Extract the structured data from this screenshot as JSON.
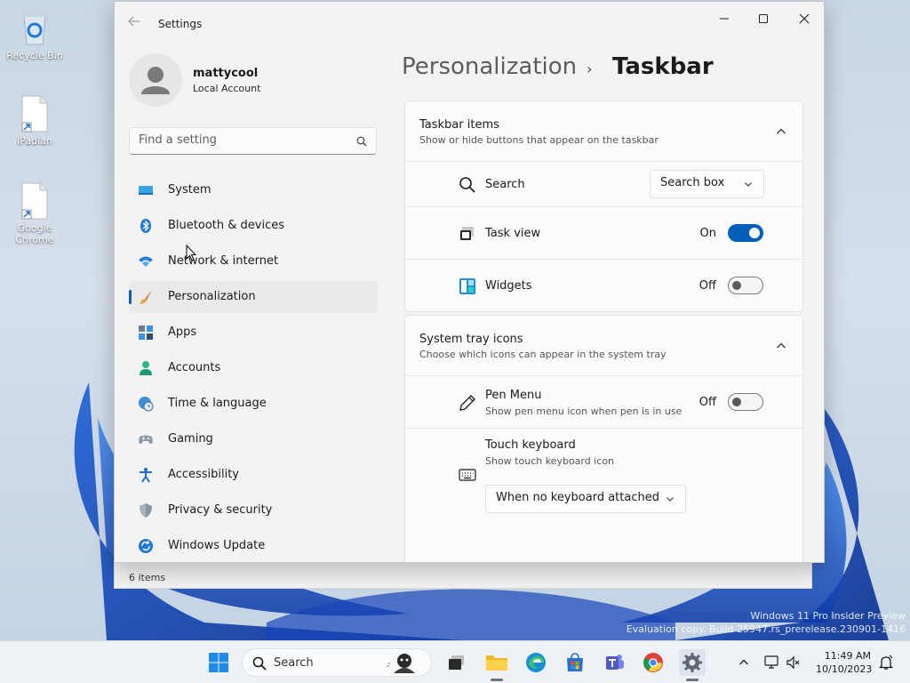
{
  "desktop": {
    "icons": [
      {
        "label": "Recycle Bin"
      },
      {
        "label": "iPadian"
      },
      {
        "label": "Google Chrome"
      }
    ],
    "watermark_line1": "Windows 11 Pro Insider Preview",
    "watermark_line2": "Evaluation copy. Build 25947.rs_prerelease.230901-1416"
  },
  "background_window": {
    "status_text": "6 items"
  },
  "window": {
    "title": "Settings"
  },
  "profile": {
    "name": "mattycool",
    "account_type": "Local Account"
  },
  "search": {
    "placeholder": "Find a setting"
  },
  "nav": {
    "items": [
      {
        "label": "System",
        "icon": "monitor-icon"
      },
      {
        "label": "Bluetooth & devices",
        "icon": "bluetooth-icon"
      },
      {
        "label": "Network & internet",
        "icon": "wifi-icon"
      },
      {
        "label": "Personalization",
        "icon": "brush-icon",
        "active": true
      },
      {
        "label": "Apps",
        "icon": "apps-icon"
      },
      {
        "label": "Accounts",
        "icon": "person-icon"
      },
      {
        "label": "Time & language",
        "icon": "globe-clock-icon"
      },
      {
        "label": "Gaming",
        "icon": "gamepad-icon"
      },
      {
        "label": "Accessibility",
        "icon": "accessibility-icon"
      },
      {
        "label": "Privacy & security",
        "icon": "shield-icon"
      },
      {
        "label": "Windows Update",
        "icon": "update-icon"
      }
    ]
  },
  "breadcrumb": {
    "parent": "Personalization",
    "separator": "›",
    "current": "Taskbar"
  },
  "taskbar_items": {
    "title": "Taskbar items",
    "subtitle": "Show or hide buttons that appear on the taskbar",
    "rows": {
      "search": {
        "label": "Search",
        "value": "Search box"
      },
      "task_view": {
        "label": "Task view",
        "state": "On"
      },
      "widgets": {
        "label": "Widgets",
        "state": "Off"
      }
    }
  },
  "system_tray": {
    "title": "System tray icons",
    "subtitle": "Choose which icons can appear in the system tray",
    "rows": {
      "pen_menu": {
        "label": "Pen Menu",
        "description": "Show pen menu icon when pen is in use",
        "state": "Off"
      },
      "touch_keyboard": {
        "label": "Touch keyboard",
        "description": "Show touch keyboard icon",
        "value": "When no keyboard attached"
      }
    }
  },
  "taskbar": {
    "search_label": "Search",
    "time": "11:49 AM",
    "date": "10/10/2023"
  },
  "colors": {
    "accent": "#005fb8",
    "window_bg": "#f3f3f3",
    "card_bg": "#fbfbfb"
  }
}
